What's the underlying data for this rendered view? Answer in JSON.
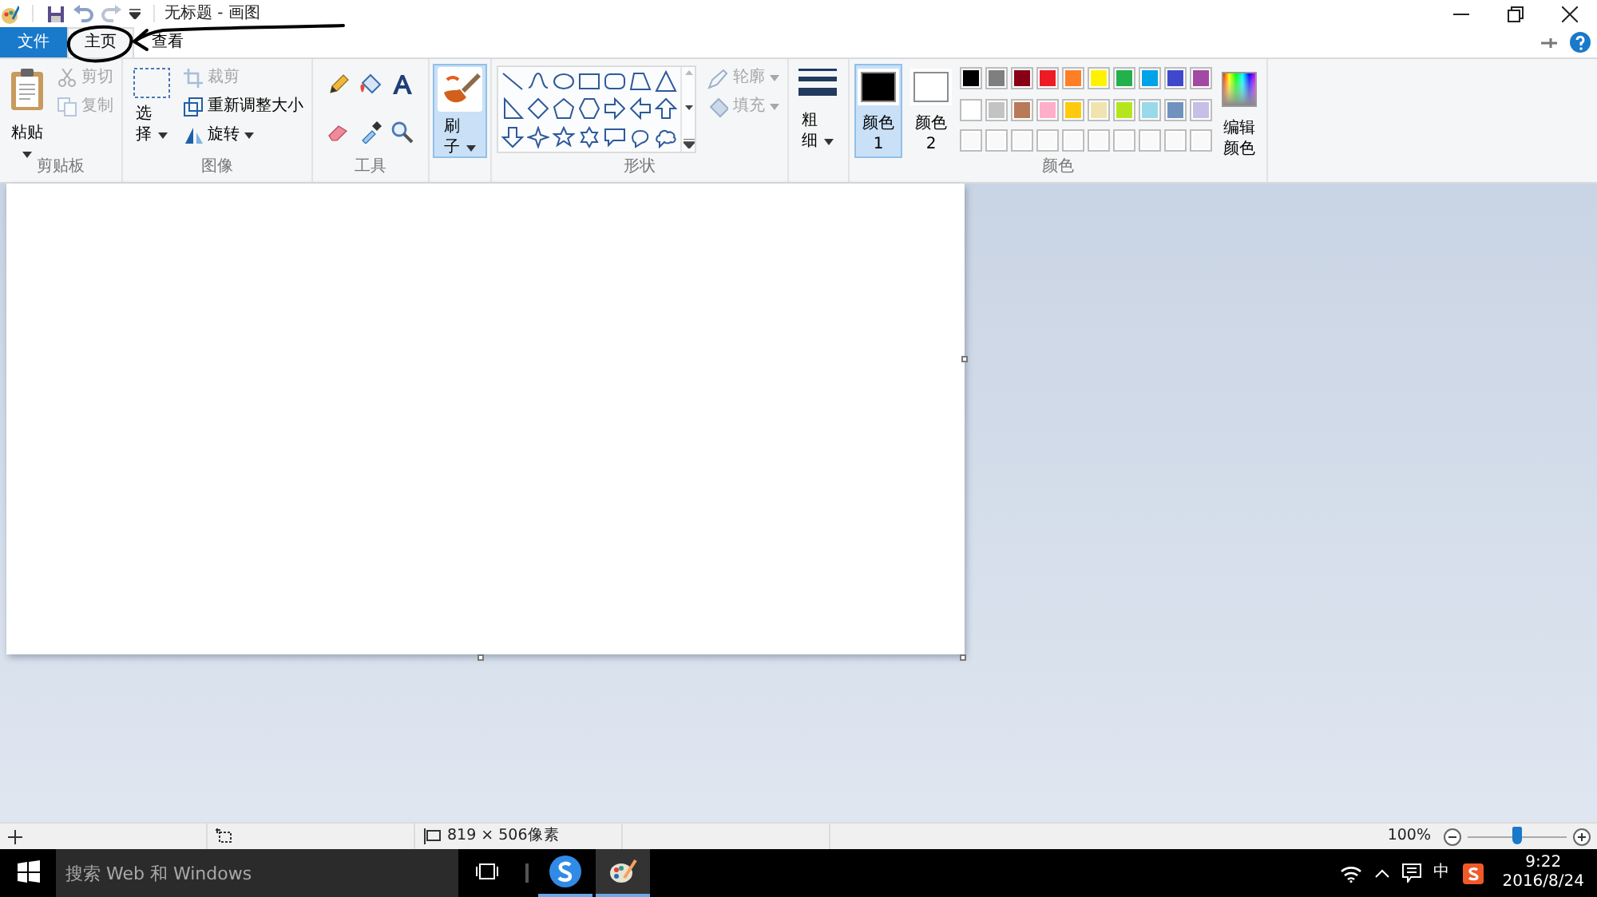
{
  "title_bar": {
    "title": "无标题 - 画图"
  },
  "tabs": [
    {
      "label": "文件",
      "kind": "file",
      "selected": false
    },
    {
      "label": "主页",
      "kind": "tab",
      "selected": true
    },
    {
      "label": "查看",
      "kind": "tab",
      "selected": false
    }
  ],
  "ribbon": {
    "clipboard": {
      "label": "剪贴板",
      "paste": "粘贴",
      "items": [
        {
          "label": "剪切",
          "disabled": true
        },
        {
          "label": "复制",
          "disabled": true
        }
      ]
    },
    "image": {
      "label": "图像",
      "select": "选择",
      "items": [
        {
          "label": "裁剪",
          "disabled": true,
          "dropdown": false
        },
        {
          "label": "重新调整大小",
          "disabled": false,
          "dropdown": false
        },
        {
          "label": "旋转",
          "disabled": false,
          "dropdown": true
        }
      ]
    },
    "tools": {
      "label": "工具"
    },
    "brushes": {
      "label": "刷子",
      "selected": true
    },
    "shapes": {
      "label": "形状",
      "outline": {
        "label": "轮廓",
        "disabled": true
      },
      "fill": {
        "label": "填充",
        "disabled": true
      }
    },
    "size": {
      "label": "粗细"
    },
    "colors": {
      "label": "颜色",
      "color_1": {
        "label": "颜色 1",
        "color": "#000000",
        "selected": true
      },
      "color_2": {
        "label": "颜色 2",
        "color": "#ffffff",
        "selected": false
      },
      "palette": [
        {
          "color": "#000000"
        },
        {
          "color": "#7f7f7f"
        },
        {
          "color": "#880015"
        },
        {
          "color": "#ed1c24"
        },
        {
          "color": "#ff7f27"
        },
        {
          "color": "#fff200"
        },
        {
          "color": "#22b14c"
        },
        {
          "color": "#00a2e8"
        },
        {
          "color": "#3f48cc"
        },
        {
          "color": "#a349a4"
        },
        {
          "color": "#ffffff"
        },
        {
          "color": "#c3c3c3"
        },
        {
          "color": "#b97a57"
        },
        {
          "color": "#ffaec9"
        },
        {
          "color": "#ffc90e"
        },
        {
          "color": "#efe4b0"
        },
        {
          "color": "#b5e61d"
        },
        {
          "color": "#99d9ea"
        },
        {
          "color": "#7092be"
        },
        {
          "color": "#c8bfe7"
        }
      ],
      "edit": "编辑颜色"
    }
  },
  "status_bar": {
    "canvas_size": "819 × 506像素",
    "zoom": "100%",
    "zoom_slider": {
      "level": 0.5
    }
  },
  "taskbar": {
    "search": {
      "placeholder": "搜索 Web 和 Windows"
    },
    "input_method": "中",
    "time": "9:22",
    "date": "2016/8/24"
  }
}
